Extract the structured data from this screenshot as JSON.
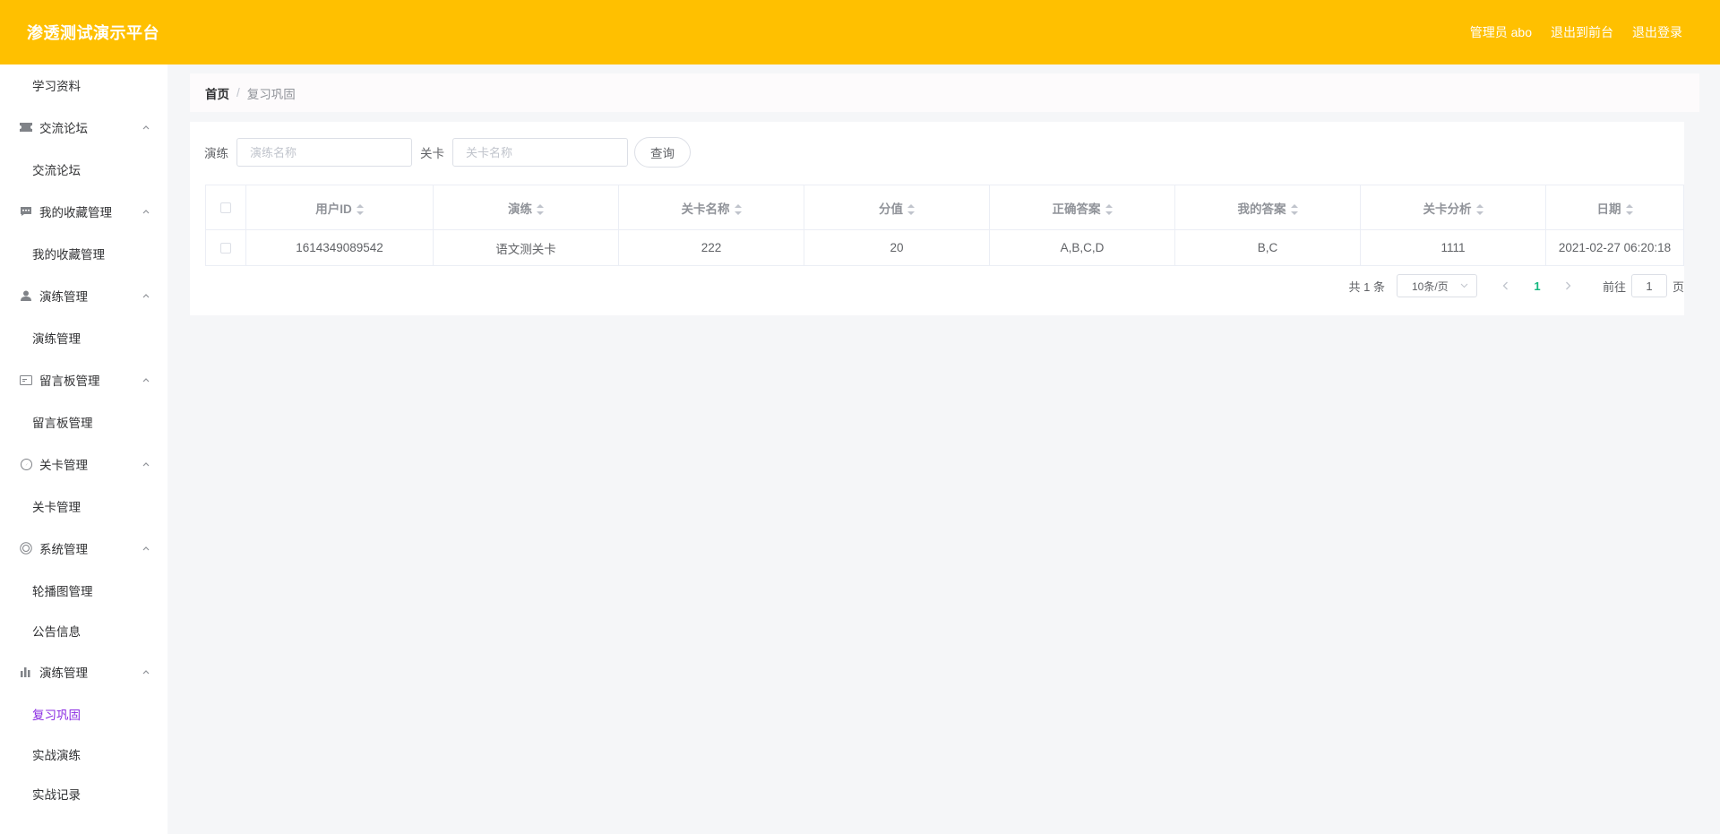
{
  "header": {
    "title": "渗透测试演示平台",
    "user": "管理员 abo",
    "back_to_front": "退出到前台",
    "logout": "退出登录"
  },
  "sidebar": {
    "top_item": "学习资料",
    "groups": [
      {
        "title": "交流论坛",
        "icon": "ticket-icon",
        "items": [
          "交流论坛"
        ]
      },
      {
        "title": "我的收藏管理",
        "icon": "chat-icon",
        "items": [
          "我的收藏管理"
        ]
      },
      {
        "title": "演练管理",
        "icon": "user-icon",
        "items": [
          "演练管理"
        ]
      },
      {
        "title": "留言板管理",
        "icon": "message-card-icon",
        "items": [
          "留言板管理"
        ]
      },
      {
        "title": "关卡管理",
        "icon": "compass-icon",
        "items": [
          "关卡管理"
        ]
      },
      {
        "title": "系统管理",
        "icon": "settings-circle-icon",
        "items": [
          "轮播图管理",
          "公告信息"
        ]
      },
      {
        "title": "演练管理",
        "icon": "bar-chart-icon",
        "items": [
          "复习巩固",
          "实战演练",
          "实战记录"
        ]
      }
    ],
    "active_item": "复习巩固"
  },
  "breadcrumb": {
    "home": "首页",
    "separator": "/",
    "current": "复习巩固"
  },
  "search": {
    "drill_label": "演练",
    "drill_placeholder": "演练名称",
    "level_label": "关卡",
    "level_placeholder": "关卡名称",
    "query_button": "查询"
  },
  "table": {
    "columns": [
      "用户ID",
      "演练",
      "关卡名称",
      "分值",
      "正确答案",
      "我的答案",
      "关卡分析",
      "日期"
    ],
    "rows": [
      [
        "1614349089542",
        "语文测关卡",
        "222",
        "20",
        "A,B,C,D",
        "B,C",
        "1111",
        "2021-02-27 06:20:18"
      ]
    ]
  },
  "pagination": {
    "total": "共 1 条",
    "page_size": "10条/页",
    "current_page": "1",
    "goto_label": "前往",
    "goto_value": "1",
    "page_suffix": "页"
  },
  "colors": {
    "header_bg": "#ffc000",
    "active_menu": "#8a2be2",
    "active_page": "#13b77e"
  }
}
